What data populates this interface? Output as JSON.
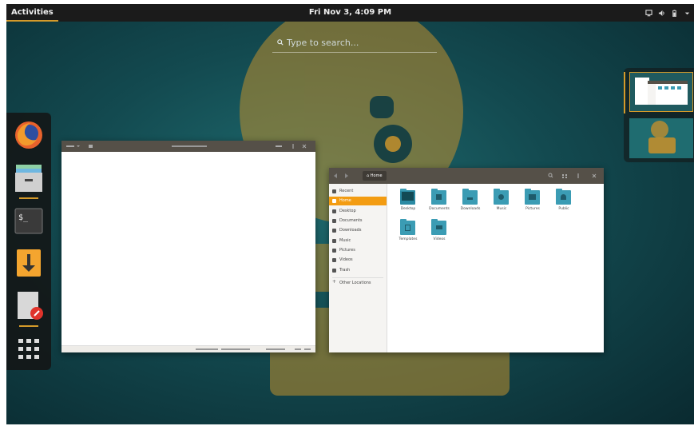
{
  "topbar": {
    "activities_label": "Activities",
    "clock": "Fri Nov 3, 4:09 PM",
    "tray": [
      "screen-icon",
      "volume-icon",
      "battery-icon",
      "dropdown-arrow-icon"
    ]
  },
  "search": {
    "placeholder": "Type to search..."
  },
  "dash": {
    "items": [
      {
        "name": "firefox-icon",
        "running": false
      },
      {
        "name": "files-icon",
        "running": true
      },
      {
        "name": "terminal-icon",
        "running": false
      },
      {
        "name": "software-install-icon",
        "running": false
      },
      {
        "name": "text-editor-icon",
        "running": true
      },
      {
        "name": "show-apps-grid-icon",
        "running": false
      }
    ]
  },
  "files": {
    "path_button": "Home",
    "sidebar": {
      "items": [
        {
          "label": "Recent",
          "icon": "clock-icon"
        },
        {
          "label": "Home",
          "icon": "home-icon",
          "active": true
        },
        {
          "label": "Desktop",
          "icon": "desktop-icon"
        },
        {
          "label": "Documents",
          "icon": "document-icon"
        },
        {
          "label": "Downloads",
          "icon": "download-icon"
        },
        {
          "label": "Music",
          "icon": "music-icon"
        },
        {
          "label": "Pictures",
          "icon": "picture-icon"
        },
        {
          "label": "Videos",
          "icon": "video-icon"
        },
        {
          "label": "Trash",
          "icon": "trash-icon"
        }
      ],
      "other_locations": "Other Locations"
    },
    "folders": [
      {
        "label": "Desktop",
        "icon": "desktop-folder-icon"
      },
      {
        "label": "Documents",
        "icon": "documents-folder-icon"
      },
      {
        "label": "Downloads",
        "icon": "downloads-folder-icon"
      },
      {
        "label": "Music",
        "icon": "music-folder-icon"
      },
      {
        "label": "Pictures",
        "icon": "pictures-folder-icon"
      },
      {
        "label": "Public",
        "icon": "public-folder-icon"
      },
      {
        "label": "Templates",
        "icon": "templates-folder-icon"
      },
      {
        "label": "Videos",
        "icon": "videos-folder-icon"
      }
    ]
  },
  "colors": {
    "accent": "#d49a2a",
    "topbar_bg": "#1b1b1b",
    "folder": "#3b9cb4",
    "sidebar_active": "#f39c12",
    "wallpaper_teal": "#1f6c70",
    "wallpaper_art": "#c08f2e"
  }
}
